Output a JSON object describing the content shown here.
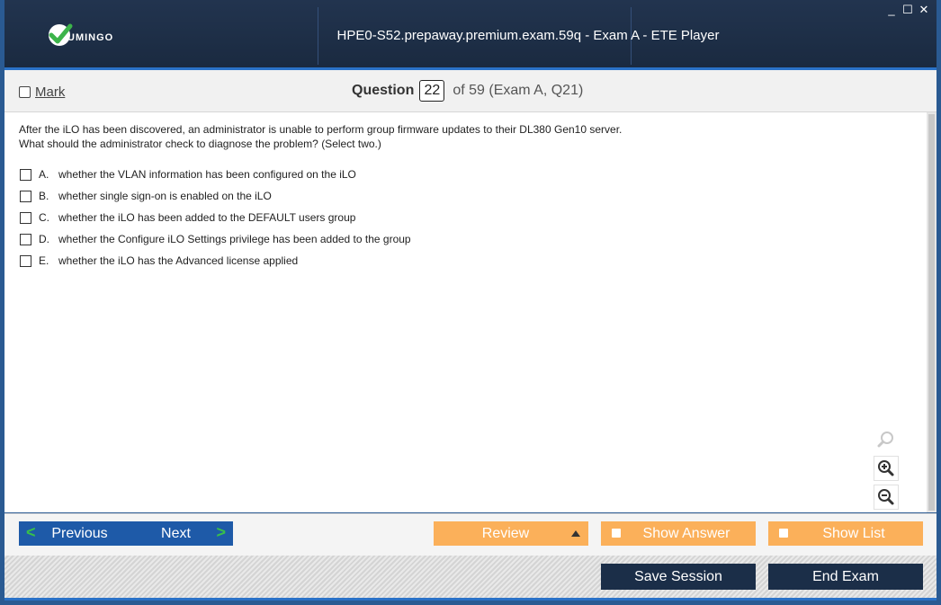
{
  "window": {
    "title": "HPE0-S52.prepaway.premium.exam.59q - Exam A - ETE Player",
    "logo_text": "UMINGO",
    "controls": [
      "_",
      "☐",
      "✕"
    ],
    "colors": {
      "titlebar": "#1f3048",
      "accent": "#2a72c8"
    }
  },
  "question_bar": {
    "mark_label": "Mark",
    "question_word": "Question",
    "question_number": "22",
    "of_text": "of 59 (Exam A, Q21)"
  },
  "question": {
    "line1": "After the iLO has been discovered, an administrator is unable to perform group firmware updates to their DL380 Gen10 server.",
    "line2": "What should the administrator check to diagnose the problem? (Select two.)",
    "options": [
      {
        "letter": "A.",
        "text": "whether the VLAN information has been configured on the iLO"
      },
      {
        "letter": "B.",
        "text": "whether single sign-on is enabled on the iLO"
      },
      {
        "letter": "C.",
        "text": "whether the iLO has been added to the DEFAULT users group"
      },
      {
        "letter": "D.",
        "text": "whether the Configure iLO Settings privilege has been added to the group"
      },
      {
        "letter": "E.",
        "text": "whether the iLO has the Advanced license applied"
      }
    ]
  },
  "zoom": {
    "icons": [
      "zoom-reset-icon",
      "zoom-in-icon",
      "zoom-out-icon"
    ]
  },
  "nav": {
    "previous": "Previous",
    "next": "Next",
    "review": "Review",
    "show_answer": "Show Answer",
    "show_list": "Show List",
    "save_session": "Save Session",
    "end_exam": "End Exam",
    "colors": {
      "blue": "#1e5aa8",
      "orange": "#fbb05a",
      "dark": "#1b2e48",
      "chevron": "#39c04a"
    }
  }
}
